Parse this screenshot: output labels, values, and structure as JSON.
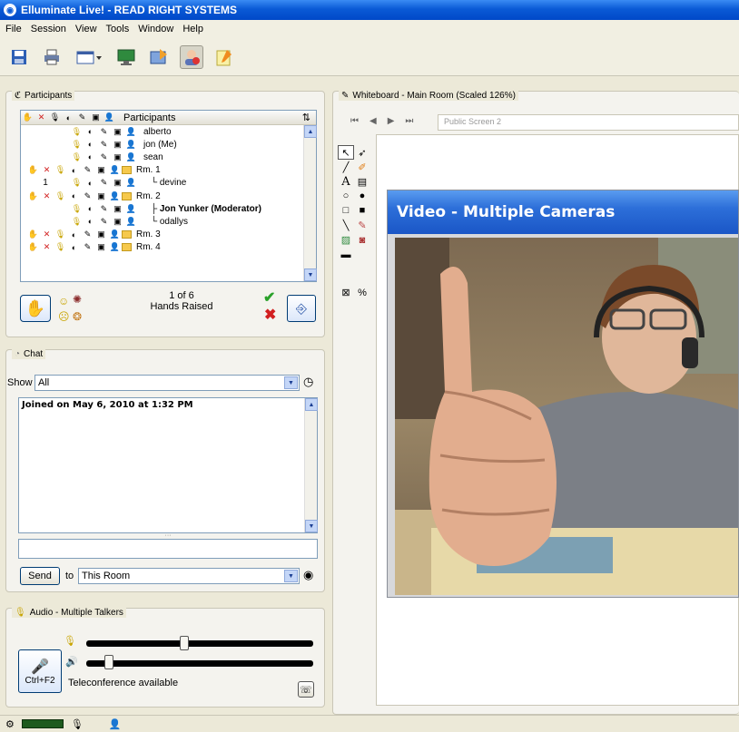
{
  "window": {
    "title": "Elluminate Live! - READ RIGHT SYSTEMS"
  },
  "menu": [
    "File",
    "Session",
    "View",
    "Tools",
    "Window",
    "Help"
  ],
  "toolbar": {
    "icons": [
      "save-icon",
      "print-icon",
      "layout-icon",
      "desktop-share-icon",
      "app-share-icon",
      "video-icon",
      "notes-icon"
    ]
  },
  "participants": {
    "panel_title": "Participants",
    "column_header": "Participants",
    "rows": [
      {
        "num": "",
        "label": "alberto",
        "room": false,
        "indent": 0,
        "bold": false
      },
      {
        "num": "",
        "label": "jon (Me)",
        "room": false,
        "indent": 0,
        "bold": false
      },
      {
        "num": "",
        "label": "sean",
        "room": false,
        "indent": 0,
        "bold": false
      },
      {
        "num": "",
        "label": "Rm. 1",
        "room": true,
        "indent": 0,
        "bold": false
      },
      {
        "num": "1",
        "label": "└ devine",
        "room": false,
        "indent": 1,
        "bold": false
      },
      {
        "num": "",
        "label": "Rm. 2",
        "room": true,
        "indent": 0,
        "bold": false
      },
      {
        "num": "",
        "label": "├ Jon Yunker (Moderator)",
        "room": false,
        "indent": 1,
        "bold": true
      },
      {
        "num": "",
        "label": "└ odallys",
        "room": false,
        "indent": 1,
        "bold": false
      },
      {
        "num": "",
        "label": "Rm. 3",
        "room": true,
        "indent": 0,
        "bold": false
      },
      {
        "num": "",
        "label": "Rm. 4",
        "room": true,
        "indent": 0,
        "bold": false
      }
    ],
    "hands_count": "1 of 6",
    "hands_label": "Hands Raised"
  },
  "chat": {
    "panel_title": "Chat",
    "show_label": "Show",
    "show_value": "All",
    "message": "Joined on May 6, 2010 at 1:32 PM",
    "input_value": "",
    "send_label": "Send",
    "to_label": "to",
    "to_value": "This Room"
  },
  "audio": {
    "panel_title": "Audio - Multiple Talkers",
    "mic_shortcut": "Ctrl+F2",
    "status": "Teleconference available",
    "mic_level": 0.43,
    "speaker_level": 0.1
  },
  "whiteboard": {
    "panel_title": "Whiteboard - Main Room (Scaled 126%)",
    "screen_name": "Public Screen 2"
  },
  "video": {
    "title": "Video - Multiple Cameras"
  },
  "colors": {
    "title_blue": "#0a5ad6",
    "room_folder": "#f6c94c",
    "check_green": "#2aa12a",
    "cancel_red": "#d21f1f"
  }
}
